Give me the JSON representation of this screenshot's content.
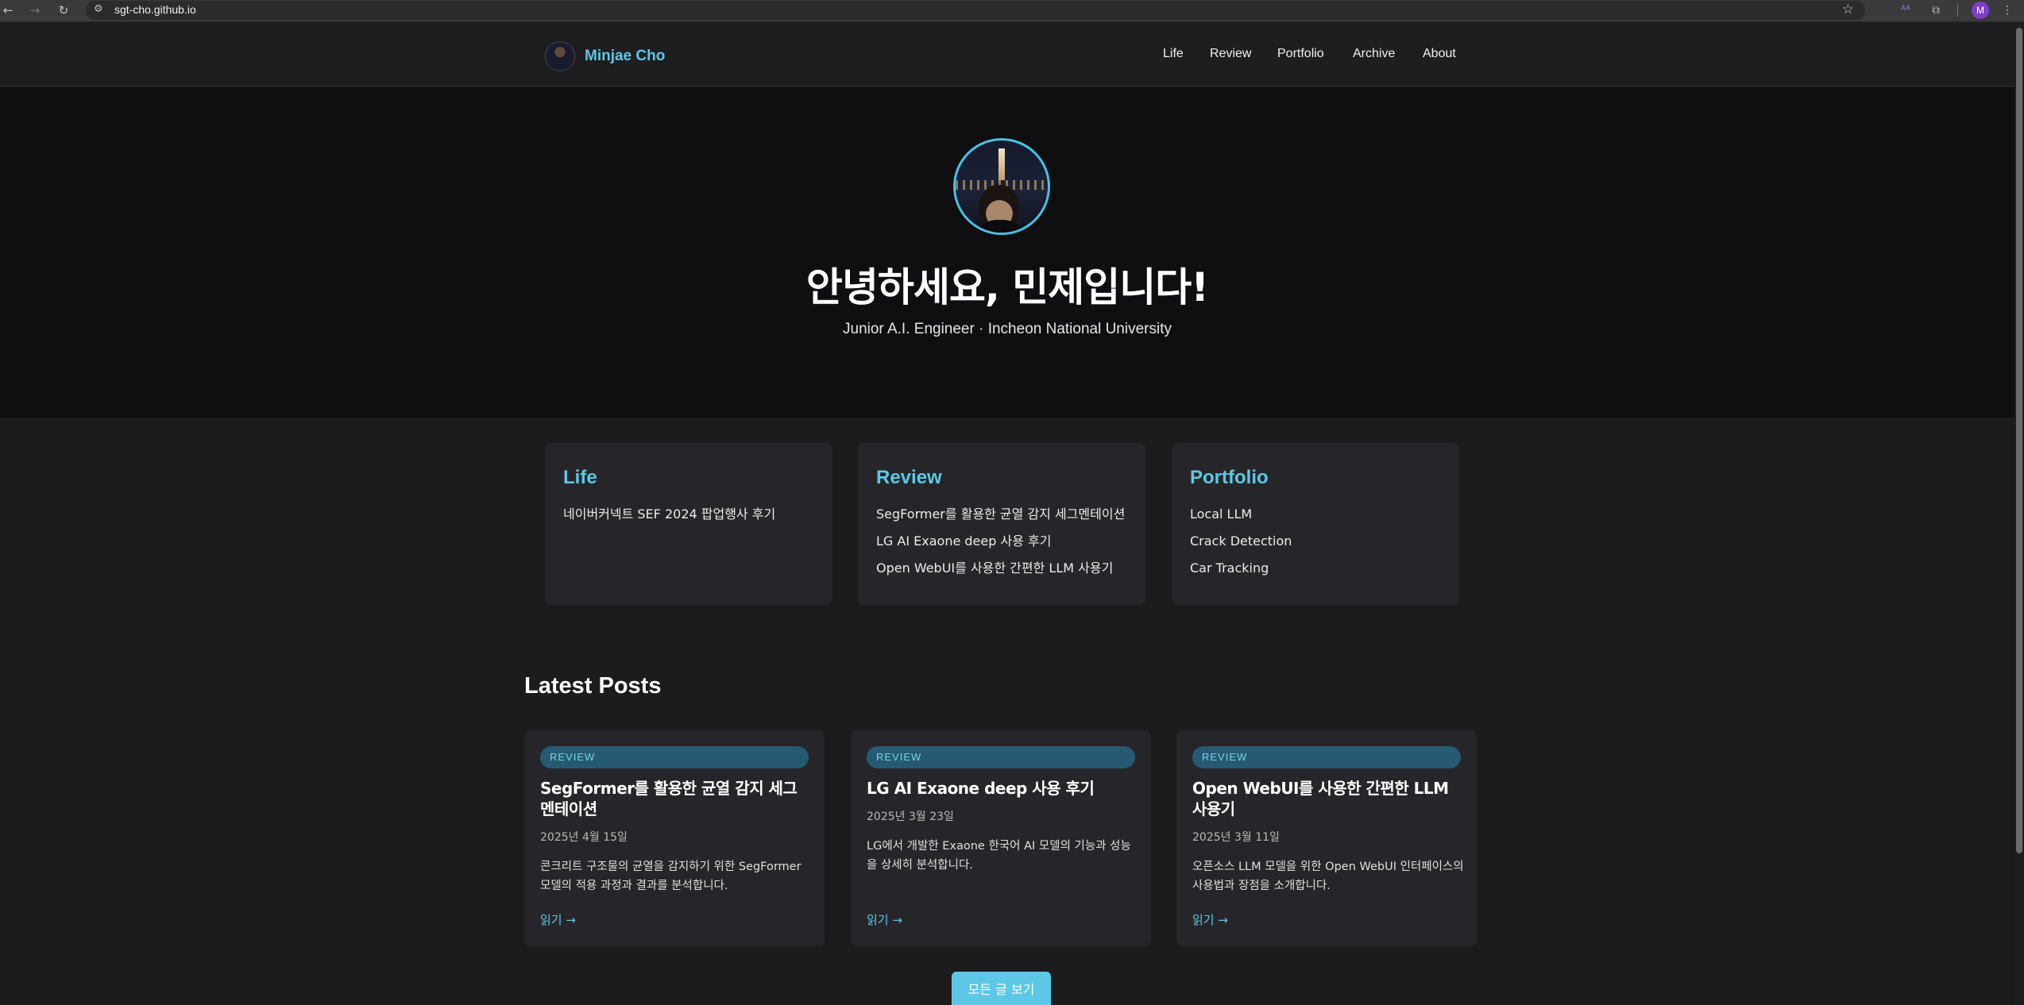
{
  "browser": {
    "url": "sgt-cho.github.io",
    "profile_initial": "M"
  },
  "header": {
    "brand": "Minjae Cho",
    "nav": [
      "Life",
      "Review",
      "Portfolio",
      "Archive",
      "About"
    ]
  },
  "hero": {
    "greeting": "안녕하세요, 민제입니다!",
    "subtitle": "Junior A.I. Engineer · Incheon National University"
  },
  "categories": [
    {
      "title": "Life",
      "items": [
        "네이버커넥트 SEF 2024 팝업행사 후기"
      ]
    },
    {
      "title": "Review",
      "items": [
        "SegFormer를 활용한 균열 감지 세그멘테이션",
        "LG AI Exaone deep 사용 후기",
        "Open WebUI를 사용한 간편한 LLM 사용기"
      ]
    },
    {
      "title": "Portfolio",
      "items": [
        "Local LLM",
        "Crack Detection",
        "Car Tracking"
      ]
    }
  ],
  "latest": {
    "title": "Latest Posts",
    "posts": [
      {
        "badge": "REVIEW",
        "title": "SegFormer를 활용한 균열 감지 세그멘테이션",
        "date": "2025년 4월 15일",
        "excerpt": "콘크리트 구조물의 균열을 감지하기 위한 SegFormer 모델의 적용 과정과 결과를 분석합니다.",
        "read": "읽기 →"
      },
      {
        "badge": "REVIEW",
        "title": "LG AI Exaone deep 사용 후기",
        "date": "2025년 3월 23일",
        "excerpt": "LG에서 개발한 Exaone 한국어 AI 모델의 기능과 성능을 상세히 분석합니다.",
        "read": "읽기 →"
      },
      {
        "badge": "REVIEW",
        "title": "Open WebUI를 사용한 간편한 LLM 사용기",
        "date": "2025년 3월 11일",
        "excerpt": "오픈소스 LLM 모델을 위한 Open WebUI 인터페이스의 사용법과 장점을 소개합니다.",
        "read": "읽기 →"
      }
    ],
    "all_button": "모든 글 보기"
  },
  "colors": {
    "accent": "#5cc8e6",
    "badge_bg": "#265a72",
    "page_bg": "#1c1c1f",
    "hero_bg": "#0f0f11",
    "card_bg": "#26262a"
  }
}
